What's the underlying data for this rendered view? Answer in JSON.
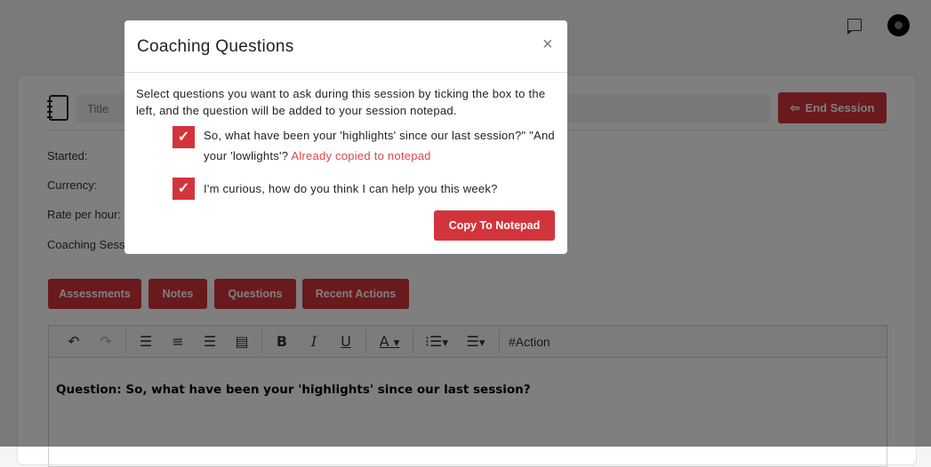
{
  "header": {
    "chat_icon": "chat-icon",
    "avatar_icon": "avatar"
  },
  "session": {
    "title_placeholder": "Title",
    "end_label": "End Session",
    "fields": [
      "Started:",
      "Currency:",
      "Rate per hour:",
      "Coaching Sess"
    ]
  },
  "tabs": [
    "Assessments",
    "Notes",
    "Questions",
    "Recent Actions"
  ],
  "editor": {
    "action_label": "#Action",
    "content": "Question: So, what have been your 'highlights' since our last session?"
  },
  "modal": {
    "title": "Coaching Questions",
    "close": "×",
    "intro": "Select questions you want to ask during this session by ticking the box to the left, and the question will be added to your session notepad.",
    "questions": [
      {
        "text": "So, what have been your 'highlights' since our last session?\" \"And your 'lowlights'?",
        "status": "Already copied to notepad",
        "checked": true
      },
      {
        "text": "I'm curious, how do you think I can help you this week?",
        "status": "",
        "checked": true
      }
    ],
    "copy_label": "Copy To Notepad"
  },
  "colors": {
    "brand": "#d3343b",
    "copied": "#e0454c"
  }
}
